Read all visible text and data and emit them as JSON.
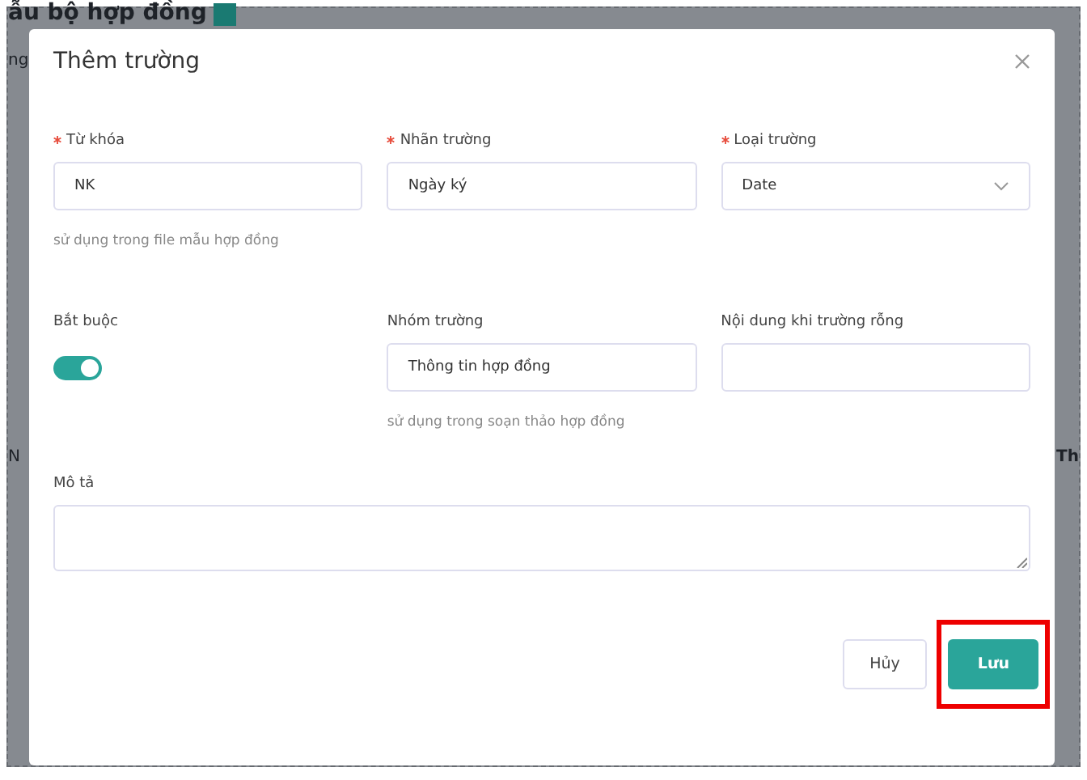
{
  "background_page": {
    "heading": "ẫu bộ hợp đồng",
    "fragments": [
      {
        "text": "ng",
        "kind": "left"
      },
      {
        "text": "N",
        "kind": "left"
      },
      {
        "text": "Th",
        "kind": "right"
      }
    ]
  },
  "dialog": {
    "title": "Thêm trường",
    "fields": [
      {
        "kind": "text",
        "label": "Từ khóa",
        "required": true,
        "value": "NK",
        "hint": "sử dụng trong file mẫu hợp đồng"
      },
      {
        "kind": "text",
        "label": "Nhãn trường",
        "required": true,
        "value": "Ngày ký"
      },
      {
        "kind": "select",
        "label": "Loại trường",
        "required": true,
        "value": "Date"
      },
      {
        "kind": "switch",
        "label": "Bắt buộc",
        "required": false,
        "on": true
      },
      {
        "kind": "text",
        "label": "Nhóm trường",
        "required": false,
        "value": "Thông tin hợp đồng",
        "hint": "sử dụng trong soạn thảo hợp đồng"
      },
      {
        "kind": "text",
        "label": "Nội dung khi trường rỗng",
        "required": false
      }
    ],
    "description": {
      "label": "Mô tả"
    },
    "buttons": [
      {
        "label": "Hủy",
        "kind": "secondary",
        "highlighted": false
      },
      {
        "label": "Lưu",
        "kind": "primary",
        "highlighted": true
      }
    ]
  }
}
